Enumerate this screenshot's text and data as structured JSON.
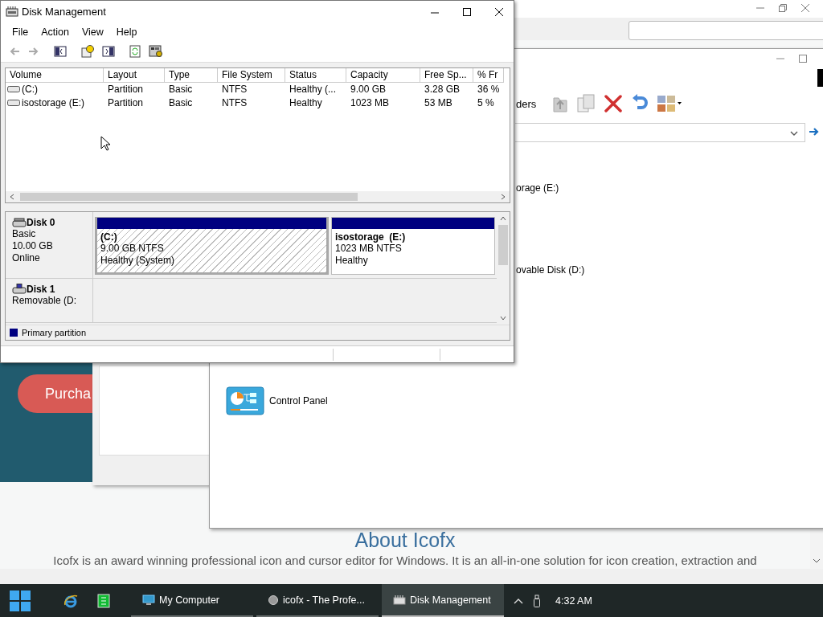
{
  "disk_management": {
    "title": "Disk Management",
    "menu": [
      "File",
      "Action",
      "View",
      "Help"
    ],
    "columns": [
      "Volume",
      "Layout",
      "Type",
      "File System",
      "Status",
      "Capacity",
      "Free Sp...",
      "% Fr"
    ],
    "rows": [
      {
        "kind": "fixed",
        "cells": [
          "(C:)",
          "Partition",
          "Basic",
          "NTFS",
          "Healthy (...",
          "9.00 GB",
          "3.28 GB",
          "36 %"
        ]
      },
      {
        "kind": "fixed",
        "cells": [
          "isostorage (E:)",
          "Partition",
          "Basic",
          "NTFS",
          "Healthy",
          "1023 MB",
          "53 MB",
          "5 %"
        ]
      }
    ],
    "disks": [
      {
        "name": "Disk 0",
        "kind": "fixed",
        "lines": [
          "Basic",
          "10.00 GB",
          "Online"
        ],
        "partitions": [
          {
            "name": "(C:)",
            "size": "9.00 GB NTFS",
            "status": "Healthy (System)",
            "selected": true
          },
          {
            "name": "isostorage  (E:)",
            "size": "1023 MB NTFS",
            "status": "Healthy",
            "selected": false
          }
        ]
      },
      {
        "name": "Disk 1",
        "kind": "removable",
        "lines": [
          "Removable (D:"
        ]
      }
    ],
    "legend": [
      {
        "label": "Primary partition",
        "color": "#000080"
      }
    ]
  },
  "browser": {
    "button": "Purcha",
    "heading": "About Icofx",
    "paragraph": "Icofx is an award winning professional icon and cursor editor for Windows. It is an all-in-one solution for icon creation, extraction and"
  },
  "my_computer": {
    "toolbar_label": "ders",
    "items": [
      {
        "label": "orage (E:)",
        "kind": "drive"
      },
      {
        "label": "ovable Disk (D:)",
        "kind": "drive"
      },
      {
        "label": "Control Panel",
        "kind": "control-panel"
      }
    ]
  },
  "taskbar": {
    "tasks": [
      {
        "label": "My Computer",
        "kind": "computer",
        "selected": false
      },
      {
        "label": "icofx - The Profe...",
        "kind": "browser",
        "selected": false
      },
      {
        "label": "Disk Management",
        "kind": "disk",
        "selected": true
      }
    ],
    "clock": "4:32 AM"
  }
}
